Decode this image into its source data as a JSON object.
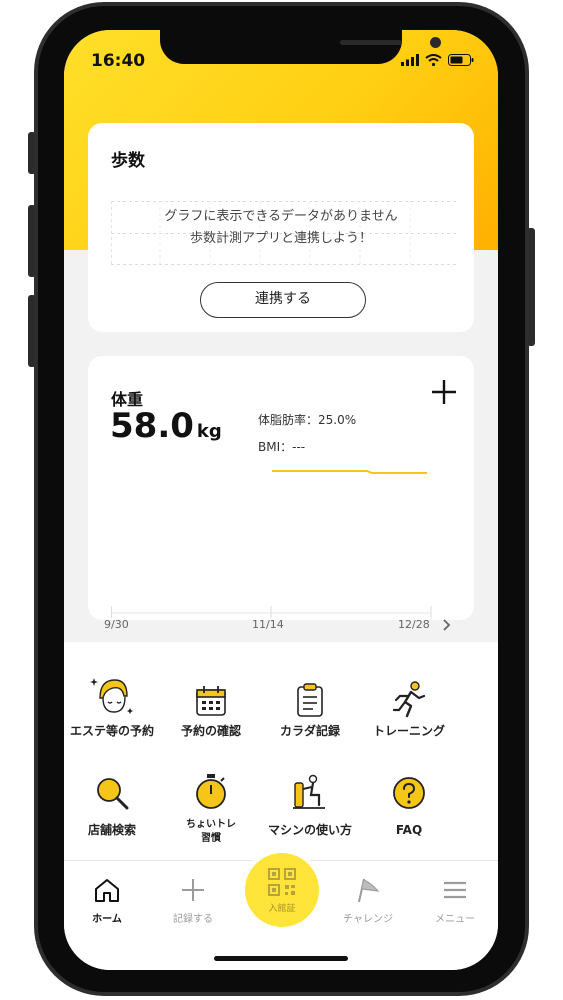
{
  "status_bar": {
    "time": "16:40"
  },
  "steps_card": {
    "title": "歩数",
    "empty_line1": "グラフに表示できるデータがありません",
    "empty_line2": "歩数計測アプリと連携しよう！",
    "connect_button": "連携する"
  },
  "weight_card": {
    "title": "体重",
    "value": "58.0",
    "unit": "kg",
    "body_fat": "体脂肪率：25.0%",
    "bmi": "BMI：---",
    "add_icon": "plus-icon",
    "x_ticks": [
      "9/30",
      "11/14",
      "12/28"
    ],
    "next_icon": "chevron-right-icon",
    "accent_color": "#f5c518"
  },
  "menu": {
    "items": [
      {
        "label": "エステ等の予約",
        "icon": "esthetic-face-icon"
      },
      {
        "label": "予約の確認",
        "icon": "calendar-icon"
      },
      {
        "label": "カラダ記録",
        "icon": "clipboard-icon"
      },
      {
        "label": "トレーニング",
        "icon": "running-icon"
      },
      {
        "label": "店舗検索",
        "icon": "search-icon"
      },
      {
        "label": "ちょいトレ",
        "label2": "習慣",
        "icon": "stopwatch-icon"
      },
      {
        "label": "マシンの使い方",
        "icon": "machine-icon"
      },
      {
        "label": "FAQ",
        "icon": "help-icon"
      }
    ]
  },
  "bottom_nav": {
    "home": "ホーム",
    "record": "記録する",
    "entry": "入館証",
    "challenge": "チャレンジ",
    "menu": "メニュー",
    "active_color": "#111111",
    "inactive_color": "#9b9b9b",
    "entry_color": "#ffe43a"
  }
}
